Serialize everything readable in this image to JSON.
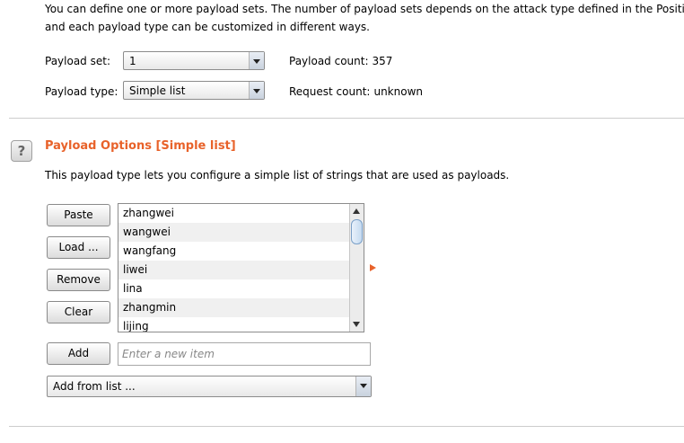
{
  "intro": {
    "line1": "You can define one or more payload sets. The number of payload sets depends on the attack type defined in the Positions t",
    "line2": "and each payload type can be customized in different ways."
  },
  "payload_set": {
    "label": "Payload set:",
    "value": "1"
  },
  "payload_type": {
    "label": "Payload type:",
    "value": "Simple list"
  },
  "payload_count": {
    "label": "Payload count:",
    "value": "357"
  },
  "request_count": {
    "label": "Request count:",
    "value": "unknown"
  },
  "options": {
    "help_icon": "question-mark-icon",
    "help_glyph": "?",
    "title": "Payload Options [Simple list]",
    "description": "This payload type lets you configure a simple list of strings that are used as payloads."
  },
  "buttons": {
    "paste": "Paste",
    "load": "Load ...",
    "remove": "Remove",
    "clear": "Clear",
    "add": "Add"
  },
  "list_items": [
    "zhangwei",
    "wangwei",
    "wangfang",
    "liwei",
    "lina",
    "zhangmin",
    "lijing"
  ],
  "new_item": {
    "placeholder": "Enter a new item",
    "value": ""
  },
  "add_from_list": {
    "value": "Add from list ..."
  },
  "colors": {
    "accent": "#e8622a",
    "scroll_thumb": "#c5daf0"
  }
}
